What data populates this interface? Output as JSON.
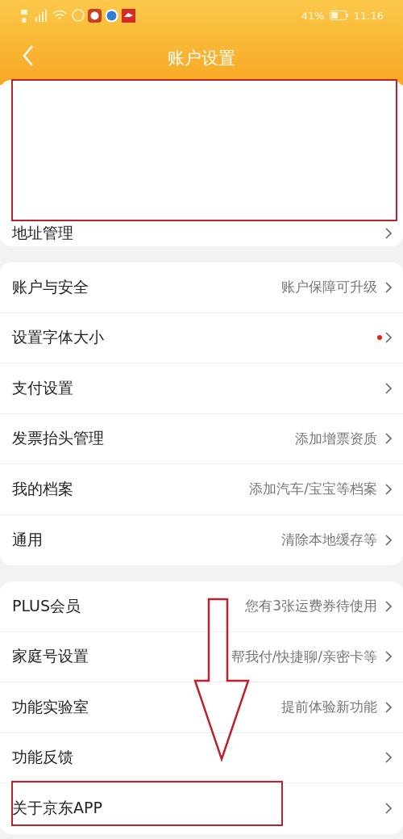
{
  "status_bar": {
    "battery": "41%",
    "time": "11:16"
  },
  "header": {
    "title": "账户设置"
  },
  "groups": [
    {
      "rows": [
        {
          "label": "地址管理",
          "value": "",
          "dot": false
        }
      ]
    },
    {
      "rows": [
        {
          "label": "账户与安全",
          "value": "账户保障可升级",
          "dot": false
        },
        {
          "label": "设置字体大小",
          "value": "",
          "dot": true
        },
        {
          "label": "支付设置",
          "value": "",
          "dot": false
        },
        {
          "label": "发票抬头管理",
          "value": "添加增票资质",
          "dot": false
        },
        {
          "label": "我的档案",
          "value": "添加汽车/宝宝等档案",
          "dot": false
        },
        {
          "label": "通用",
          "value": "清除本地缓存等",
          "dot": false
        }
      ]
    },
    {
      "rows": [
        {
          "label": "PLUS会员",
          "value": "您有3张运费券待使用",
          "dot": false
        },
        {
          "label": "家庭号设置",
          "value": "帮我付/快捷聊/亲密卡等",
          "dot": false
        },
        {
          "label": "功能实验室",
          "value": "提前体验新功能",
          "dot": false
        },
        {
          "label": "功能反馈",
          "value": "",
          "dot": false
        },
        {
          "label": "关于京东APP",
          "value": "",
          "dot": false
        }
      ]
    }
  ]
}
